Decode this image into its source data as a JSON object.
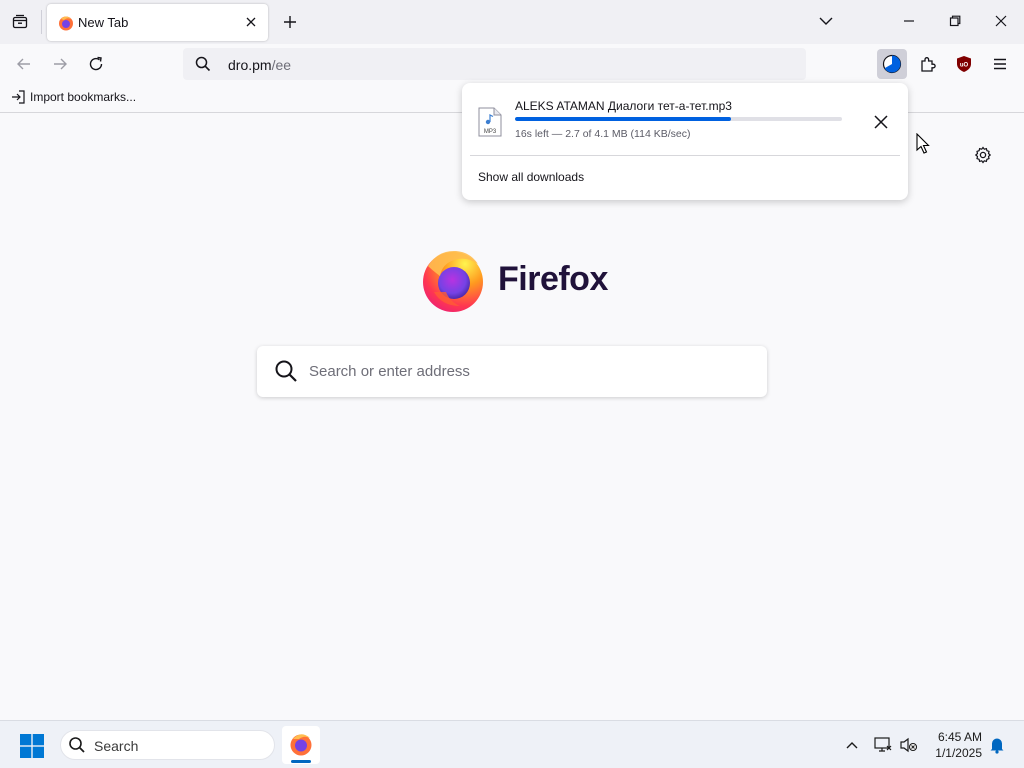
{
  "tab": {
    "title": "New Tab"
  },
  "urlbar": {
    "host": "dro.pm",
    "path": "/ee"
  },
  "bookmarks": {
    "import_label": "Import bookmarks..."
  },
  "newtab": {
    "brand": "Firefox",
    "search_placeholder": "Search or enter address"
  },
  "downloads": {
    "file_name": "ALEKS ATAMAN Диалоги тет-а-тет.mp3",
    "file_type": "MP3",
    "status": "16s left — 2.7 of 4.1 MB (114 KB/sec)",
    "progress_percent": 66,
    "show_all_label": "Show all downloads"
  },
  "taskbar": {
    "search_label": "Search",
    "time": "6:45 AM",
    "date": "1/1/2025"
  },
  "colors": {
    "accent": "#0061e0",
    "tab_strip": "#f0f0f4",
    "page_bg": "#f9f9fb"
  }
}
